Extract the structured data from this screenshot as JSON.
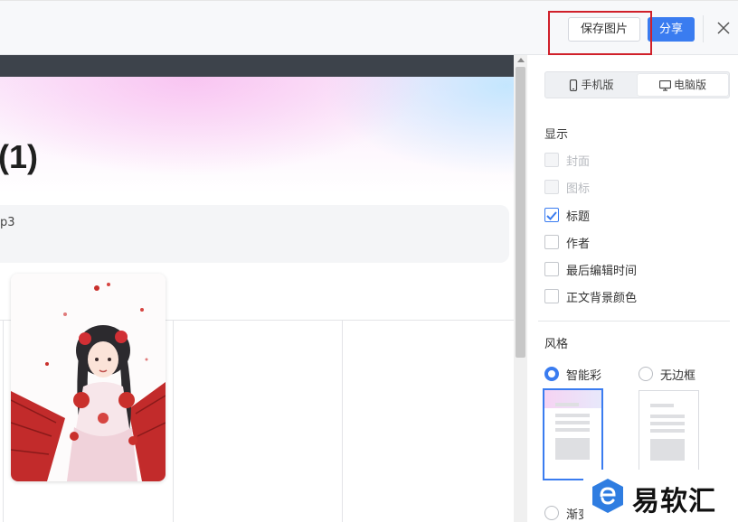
{
  "toolbar": {
    "save_image_label": "保存图片",
    "share_label": "分享"
  },
  "document": {
    "title": "(1)",
    "info_text": "p3"
  },
  "panel": {
    "view_mode": {
      "mobile_label": "手机版",
      "desktop_label": "电脑版",
      "selected": "电脑版"
    },
    "display": {
      "title": "显示",
      "options": [
        {
          "label": "封面",
          "checked": false,
          "disabled": true
        },
        {
          "label": "图标",
          "checked": false,
          "disabled": true
        },
        {
          "label": "标题",
          "checked": true,
          "disabled": false
        },
        {
          "label": "作者",
          "checked": false,
          "disabled": false
        },
        {
          "label": "最后编辑时间",
          "checked": false,
          "disabled": false
        },
        {
          "label": "正文背景颜色",
          "checked": false,
          "disabled": false
        }
      ]
    },
    "style": {
      "title": "风格",
      "options": [
        {
          "label": "智能彩",
          "selected": true
        },
        {
          "label": "无边框",
          "selected": false
        },
        {
          "label": "渐变",
          "selected": false
        }
      ]
    }
  },
  "watermark": {
    "text": "易软汇"
  },
  "colors": {
    "accent": "#3a7cf0",
    "highlight_box": "#d0202a",
    "header_strip": "#3d434b"
  }
}
